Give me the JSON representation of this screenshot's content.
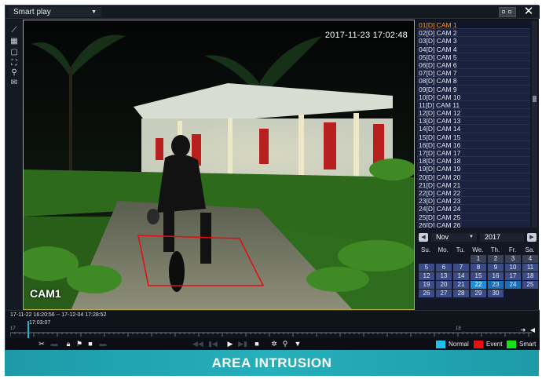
{
  "topbar": {
    "mode": "Smart play",
    "close_label": "✕"
  },
  "tools": [
    {
      "icon": "line-tool-icon",
      "glyph": "⟋"
    },
    {
      "icon": "area-tool-icon",
      "glyph": "▦"
    },
    {
      "icon": "rectangle-tool-icon",
      "glyph": "▢"
    },
    {
      "icon": "expand-tool-icon",
      "glyph": "⛶"
    },
    {
      "icon": "person-tool-icon",
      "glyph": "⚲"
    },
    {
      "icon": "mail-tool-icon",
      "glyph": "✉"
    }
  ],
  "video": {
    "timestamp": "2017-11-23 17:02:48",
    "camera_label": "CAM1",
    "zone_color": "#e01010"
  },
  "camera_list": [
    "01[D] CAM 1",
    "02[D] CAM 2",
    "03[D] CAM 3",
    "04[D] CAM 4",
    "05[D] CAM 5",
    "06[D] CAM 6",
    "07[D] CAM 7",
    "08[D] CAM 8",
    "09[D] CAM 9",
    "10[D] CAM 10",
    "11[D] CAM 11",
    "12[D] CAM 12",
    "13[D] CAM 13",
    "14[D] CAM 14",
    "15[D] CAM 15",
    "16[D] CAM 16",
    "17[D] CAM 17",
    "18[D] CAM 18",
    "19[D] CAM 19",
    "20[D] CAM 20",
    "21[D] CAM 21",
    "22[D] CAM 22",
    "23[D] CAM 23",
    "24[D] CAM 24",
    "25[D] CAM 25",
    "26[D] CAM 26"
  ],
  "active_camera_index": 0,
  "calendar": {
    "month": "Nov",
    "year": "2017",
    "weekdays": [
      "Su.",
      "Mo.",
      "Tu.",
      "We.",
      "Th.",
      "Fr.",
      "Sa."
    ],
    "days": [
      "",
      "",
      "",
      "1",
      "2",
      "3",
      "4",
      "5",
      "6",
      "7",
      "8",
      "9",
      "10",
      "11",
      "12",
      "13",
      "14",
      "15",
      "16",
      "17",
      "18",
      "19",
      "20",
      "21",
      "22",
      "23",
      "24",
      "25",
      "26",
      "27",
      "28",
      "29",
      "30",
      "",
      ""
    ],
    "selected_day": "22",
    "highlight_days": [
      "23",
      "24"
    ]
  },
  "timeline": {
    "range": "17-11-22 16:20:56 -- 17-12-04 17:28:52",
    "current_time": "17:03:07",
    "start_tick": "17",
    "end_tick": "18"
  },
  "legend": [
    {
      "label": "Normal",
      "color": "#1ec2e8"
    },
    {
      "label": "Event",
      "color": "#e81010"
    },
    {
      "label": "Smart",
      "color": "#18e018"
    }
  ],
  "caption": "AREA INTRUSION"
}
